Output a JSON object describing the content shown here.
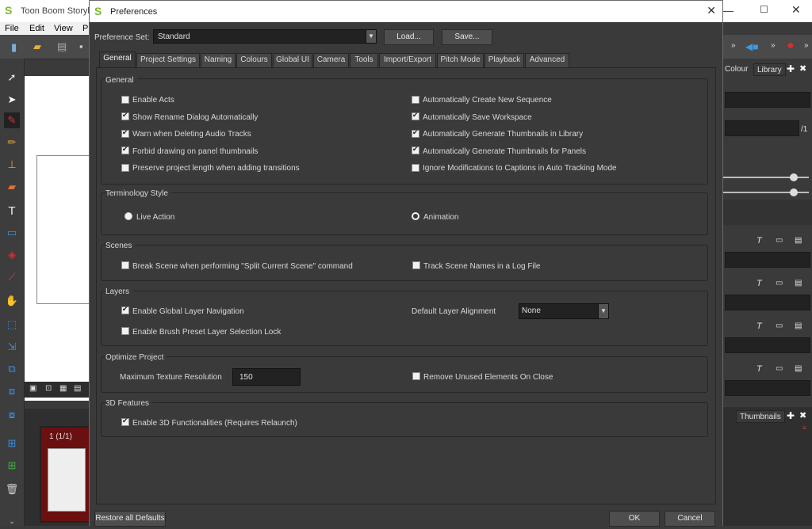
{
  "app": {
    "title": "Toon Boom Storyb",
    "menu": [
      "File",
      "Edit",
      "View",
      "P"
    ]
  },
  "thumbnail": {
    "label": "1 (1/1)"
  },
  "right_panel": {
    "tabs": [
      "Colour",
      "Library"
    ],
    "page_suffix": "/1",
    "thumbnails_tab": "Thumbnails"
  },
  "dialog": {
    "title": "Preferences",
    "preference_set_label": "Preference Set:",
    "preference_set_value": "Standard",
    "load_button": "Load...",
    "save_button": "Save...",
    "tabs": [
      "General",
      "Project Settings",
      "Naming",
      "Colours",
      "Global UI",
      "Camera",
      "Tools",
      "Import/Export",
      "Pitch Mode",
      "Playback",
      "Advanced"
    ],
    "active_tab": "General",
    "groups": {
      "general": {
        "title": "General",
        "left": [
          {
            "label": "Enable Acts",
            "checked": false
          },
          {
            "label": "Show Rename Dialog Automatically",
            "checked": true
          },
          {
            "label": "Warn when Deleting Audio Tracks",
            "checked": true
          },
          {
            "label": "Forbid drawing on panel thumbnails",
            "checked": true
          },
          {
            "label": "Preserve project length when adding transitions",
            "checked": false
          }
        ],
        "right": [
          {
            "label": "Automatically Create New Sequence",
            "checked": false
          },
          {
            "label": "Automatically Save Workspace",
            "checked": true
          },
          {
            "label": "Automatically Generate Thumbnails in Library",
            "checked": true
          },
          {
            "label": "Automatically Generate Thumbnails for Panels",
            "checked": true
          },
          {
            "label": "Ignore Modifications to Captions in Auto Tracking Mode",
            "checked": false
          }
        ]
      },
      "terminology": {
        "title": "Terminology Style",
        "live_action": "Live Action",
        "animation": "Animation",
        "selected": "Live Action"
      },
      "scenes": {
        "title": "Scenes",
        "break_scene": {
          "label": "Break Scene when performing \"Split Current Scene\" command",
          "checked": false
        },
        "track_names": {
          "label": "Track Scene Names in a Log File",
          "checked": false
        }
      },
      "layers": {
        "title": "Layers",
        "global_nav": {
          "label": "Enable Global Layer Navigation",
          "checked": true
        },
        "brush_lock": {
          "label": "Enable Brush Preset Layer Selection Lock",
          "checked": false
        },
        "alignment_label": "Default Layer Alignment",
        "alignment_value": "None"
      },
      "optimize": {
        "title": "Optimize Project",
        "max_texture_label": "Maximum Texture Resolution",
        "max_texture_value": "150",
        "remove_unused": {
          "label": "Remove Unused Elements On Close",
          "checked": false
        }
      },
      "features3d": {
        "title": "3D Features",
        "enable3d": {
          "label": "Enable 3D Functionalities (Requires Relaunch)",
          "checked": true
        }
      }
    },
    "restore_button": "Restore all Defaults",
    "ok_button": "OK",
    "cancel_button": "Cancel"
  }
}
